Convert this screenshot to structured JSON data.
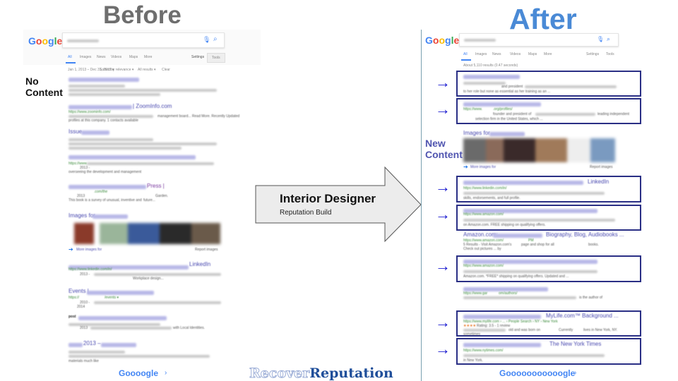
{
  "before": {
    "title": "Before",
    "label": [
      "No",
      "Content"
    ],
    "tabs": [
      "All",
      "Images",
      "News",
      "Videos",
      "Maps",
      "More",
      "Settings",
      "Tools"
    ],
    "filters": [
      "Jan 1, 2013 – Dec 31, 2013 ▾",
      "Sorted by relevance ▾",
      "All results ▾",
      "Clear"
    ],
    "results": [
      {
        "title": "| ZoomInfo.com",
        "url": "https://www.zoominfo.com/",
        "snippet": "management board... Read More. Recently Updated",
        "snippet2": "profiles at this company. 1 contacts available"
      },
      {
        "title": "Issue"
      },
      {
        "url": "https://www.",
        "year": "2013 -",
        "snippet": "overseeing the development and management"
      },
      {
        "title": "Press |",
        "url": ".com/the",
        "year": "2013",
        "extra": "Garden.",
        "snippet": "This book is a survey of unusual, inventive and",
        "snippet_end": "future..."
      },
      {
        "title": "LinkedIn",
        "url": "https://www.linkedin.com/in/",
        "year": "2013 -",
        "snippet": "Workplace design..."
      },
      {
        "title": "Events |",
        "url": "https://",
        "url_end": "/events ▾",
        "year": "2010 -",
        "year2": "2014"
      },
      {
        "title": "post",
        "year": "2013",
        "snippet": "with Local Identities."
      },
      {
        "title": "2013 –",
        "snippet": "materials much like"
      }
    ],
    "images": {
      "heading": "Images for",
      "more": "More images for",
      "report": "Report images"
    },
    "footer": "Goooogle"
  },
  "after": {
    "title": "After",
    "label": [
      "New",
      "Content"
    ],
    "tabs": [
      "All",
      "Images",
      "News",
      "Videos",
      "Maps",
      "More",
      "Settings",
      "Tools"
    ],
    "stats": "About 5,110 results (0.47 seconds)",
    "results": [
      {
        "snippet": "and president",
        "snippet2": "to her role but none as essential as her training as an ..."
      },
      {
        "url": "https://www.",
        "url_mid": ".org/profiles/",
        "snippet": "founder and president of",
        "snippet_end": "leading independent",
        "snippet2": "selection firm in the United States, which ..."
      },
      {
        "title": "LinkedIn",
        "url": "https://www.linkedin.com/in/",
        "snippet": "skills, endorsements, and full profile."
      },
      {
        "url": "https://www.amazon.com/",
        "snippet": "on Amazon.com. FREE shipping on qualifying offers."
      },
      {
        "title": "Amazon.com:",
        "title_end": "Biography, Blog, Audiobooks ...",
        "url": "https://www.amazon.com/",
        "url_end": "PM",
        "snippet": "5 Results - Visit Amazon.com's",
        "snippet_mid": "page and shop for all",
        "snippet_end": "books.",
        "snippet2": "Check out pictures ... by"
      },
      {
        "url": "https://www.amazon.com/",
        "snippet": "Amazon.com. *FREE* shipping on qualifying offers. Updated and ..."
      },
      {
        "url": "https://www.gar",
        "url_mid": "om/authors/",
        "snippet": "is the author of"
      },
      {
        "title": "MyLife.com™ Background ...",
        "url": "https://www.mylife.com › ... › People Search › NY › New York",
        "stars": "★★★★",
        "rating": "Rating: 3.5 - 1 review",
        "snippet": "old and was born on",
        "snippet_end": "Currently",
        "snippet_end2": "lives in New York, NY.",
        "snippet2": "sometimes"
      },
      {
        "title": "The New York Times",
        "url": "https://www.nytimes.com/",
        "snippet": "in New York."
      }
    ],
    "images": {
      "heading": "Images for",
      "more": "More images for",
      "report": "Report images"
    },
    "footer": "Gooooooooooogle"
  },
  "arrow": {
    "title": "Interior Designer",
    "subtitle": "Reputation Build"
  },
  "logo": {
    "part1": "Recover",
    "part2": "Reputation"
  },
  "colors": {
    "before_title": "#6e6e6e",
    "after_title": "#4a8ad6",
    "highlight_box": "#2a2f85",
    "arrow_icon": "#1a1ad0",
    "logo_light": "#9fb0d8",
    "logo_dark": "#1f4e9a"
  }
}
